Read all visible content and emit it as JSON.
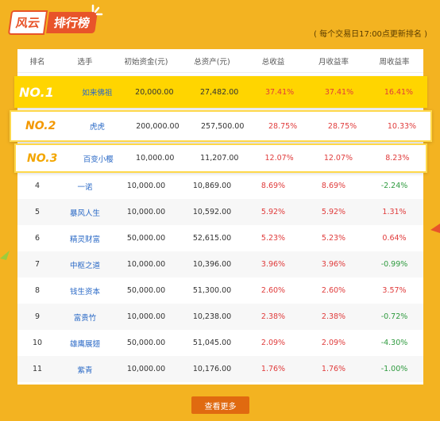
{
  "header": {
    "logo_part1": "风云",
    "logo_part2": "排行榜",
    "note": "( 每个交易日17:00点更新排名 )"
  },
  "columns": [
    "排名",
    "选手",
    "初始资金(元)",
    "总资产(元)",
    "总收益",
    "月收益率",
    "周收益率"
  ],
  "top_rows": [
    {
      "rank": "NO.1",
      "name": "如来佛祖",
      "initial": "20,000.00",
      "total": "27,482.00",
      "total_return": "37.41%",
      "month_return": "37.41%",
      "week_return": "16.41%"
    },
    {
      "rank": "NO.2",
      "name": "虎虎",
      "initial": "200,000.00",
      "total": "257,500.00",
      "total_return": "28.75%",
      "month_return": "28.75%",
      "week_return": "10.33%"
    },
    {
      "rank": "NO.3",
      "name": "百变小樱",
      "initial": "10,000.00",
      "total": "11,207.00",
      "total_return": "12.07%",
      "month_return": "12.07%",
      "week_return": "8.23%"
    }
  ],
  "rows": [
    {
      "rank": "4",
      "name": "一诺",
      "initial": "10,000.00",
      "total": "10,869.00",
      "total_return": "8.69%",
      "month_return": "8.69%",
      "week_return": "-2.24%"
    },
    {
      "rank": "5",
      "name": "暴风人生",
      "initial": "10,000.00",
      "total": "10,592.00",
      "total_return": "5.92%",
      "month_return": "5.92%",
      "week_return": "1.31%"
    },
    {
      "rank": "6",
      "name": "精灵财富",
      "initial": "50,000.00",
      "total": "52,615.00",
      "total_return": "5.23%",
      "month_return": "5.23%",
      "week_return": "0.64%"
    },
    {
      "rank": "7",
      "name": "中枢之道",
      "initial": "10,000.00",
      "total": "10,396.00",
      "total_return": "3.96%",
      "month_return": "3.96%",
      "week_return": "-0.99%"
    },
    {
      "rank": "8",
      "name": "钱生资本",
      "initial": "50,000.00",
      "total": "51,300.00",
      "total_return": "2.60%",
      "month_return": "2.60%",
      "week_return": "3.57%"
    },
    {
      "rank": "9",
      "name": "富贵竹",
      "initial": "10,000.00",
      "total": "10,238.00",
      "total_return": "2.38%",
      "month_return": "2.38%",
      "week_return": "-0.72%"
    },
    {
      "rank": "10",
      "name": "雄鹰展翅",
      "initial": "50,000.00",
      "total": "51,045.00",
      "total_return": "2.09%",
      "month_return": "2.09%",
      "week_return": "-4.30%"
    },
    {
      "rank": "11",
      "name": "紫青",
      "initial": "10,000.00",
      "total": "10,176.00",
      "total_return": "1.76%",
      "month_return": "1.76%",
      "week_return": "-1.00%"
    }
  ],
  "more_button": "查看更多",
  "colors": {
    "background": "#f3b321",
    "top1_bg": "#ffd500",
    "rank_orange": "#f39800",
    "positive": "#e03c3c",
    "negative": "#2e9a3e",
    "link_blue": "#2a69c6",
    "button": "#e06a10"
  }
}
